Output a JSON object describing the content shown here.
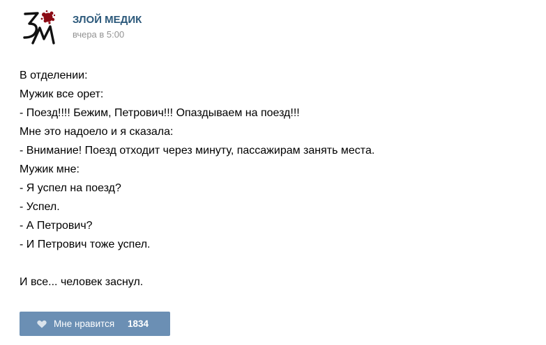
{
  "post": {
    "author": {
      "name": "ЗЛОЙ МЕДИК",
      "avatar_icon": "community-logo-icon",
      "avatar_letters": "ЗМ",
      "avatar_colors": {
        "ink": "#111111",
        "blot": "#8b0a14"
      }
    },
    "date": "вчера в 5:00",
    "text_lines": [
      "В отделении:",
      "Мужик все орет:",
      "- Поезд!!!! Бежим, Петрович!!! Опаздываем на поезд!!!",
      "Мне это надоело и я сказала:",
      "- Внимание! Поезд отходит через минуту, пассажирам занять места.",
      "Мужик мне:",
      "- Я успел на поезд?",
      "- Успел.",
      "- А Петрович?",
      "- И Петрович тоже успел.",
      "",
      "И все... человек заснул."
    ],
    "like": {
      "icon": "heart-icon",
      "label": "Мне нравится",
      "count": "1834"
    }
  },
  "colors": {
    "author_link": "#2b587a",
    "date": "#939393",
    "like_button_bg": "#6b8fb4",
    "like_button_text": "#ffffff"
  }
}
